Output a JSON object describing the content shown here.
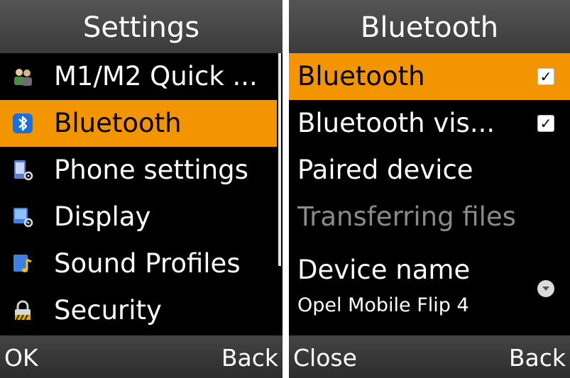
{
  "left_screen": {
    "title": "Settings",
    "items": [
      {
        "label": "M1/M2 Quick ...",
        "icon": "contacts-icon"
      },
      {
        "label": "Bluetooth",
        "icon": "bluetooth-icon"
      },
      {
        "label": "Phone settings",
        "icon": "phone-settings-icon"
      },
      {
        "label": "Display",
        "icon": "display-settings-icon"
      },
      {
        "label": "Sound Profiles",
        "icon": "sound-profiles-icon"
      },
      {
        "label": "Security",
        "icon": "lock-icon"
      }
    ],
    "selected_index": 1,
    "softkeys": {
      "left": "OK",
      "right": "Back"
    }
  },
  "right_screen": {
    "title": "Bluetooth",
    "items": [
      {
        "label": "Bluetooth",
        "checked": true
      },
      {
        "label": "Bluetooth vis...",
        "checked": true
      },
      {
        "label": "Paired device"
      },
      {
        "label": "Transferring files",
        "disabled": true
      },
      {
        "label": "Device name",
        "value": "Opel Mobile Flip 4"
      }
    ],
    "selected_index": 0,
    "softkeys": {
      "left": "Close",
      "right": "Back"
    }
  },
  "colors": {
    "highlight": "#f39500",
    "background": "#000000",
    "disabled_text": "#8a8a8a"
  }
}
